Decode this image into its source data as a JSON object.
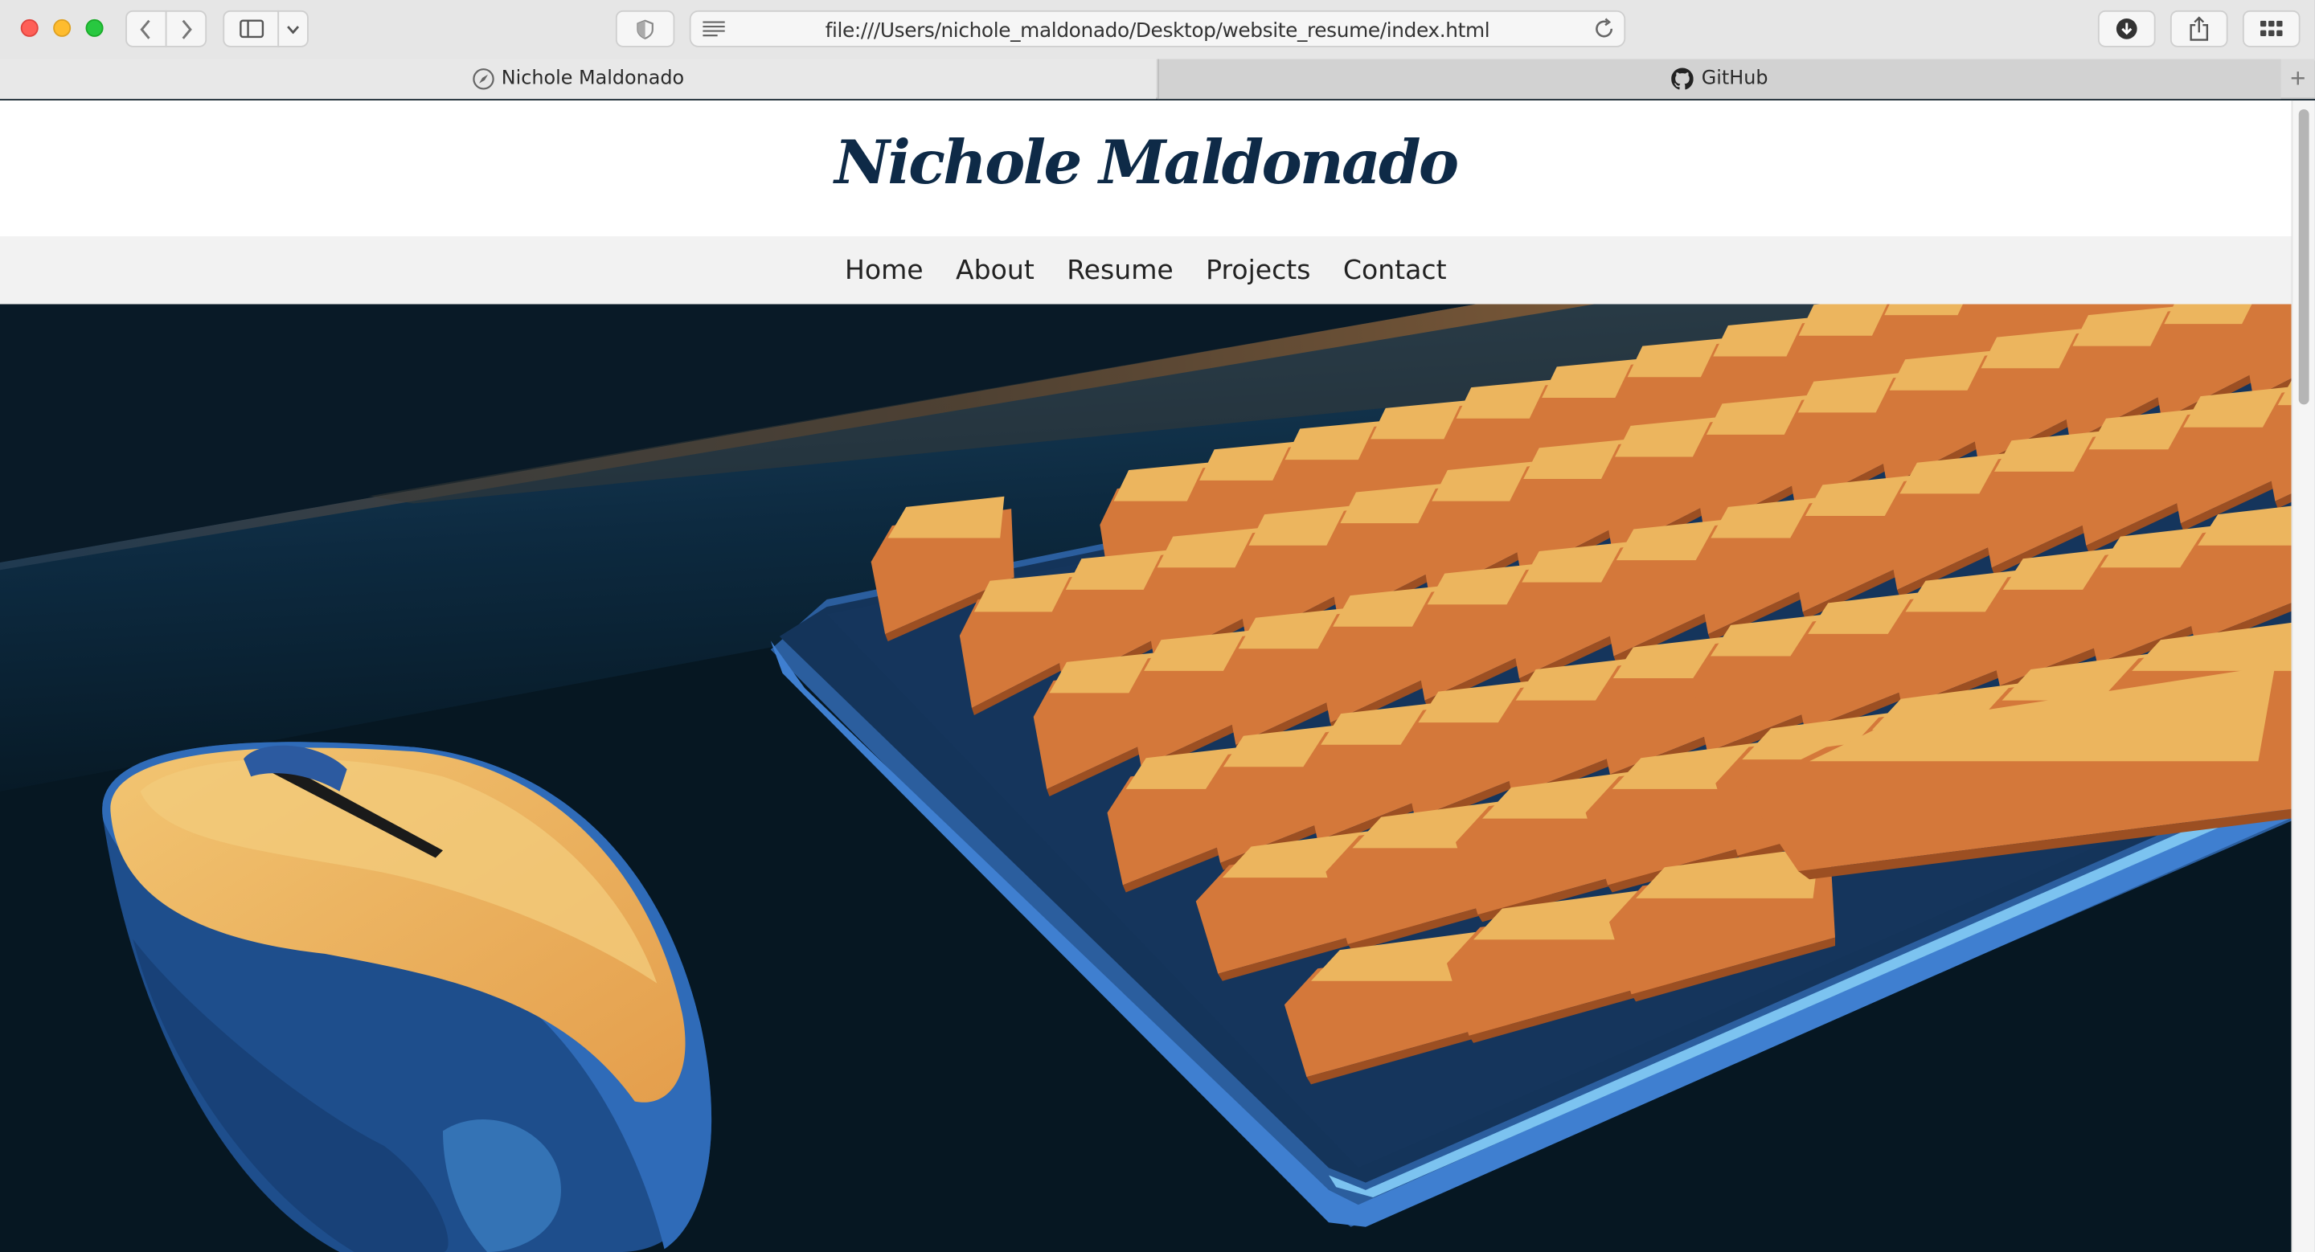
{
  "browser": {
    "url": "file:///Users/nichole_maldonado/Desktop/website_resume/index.html",
    "tabs": [
      {
        "label": "Nichole Maldonado",
        "icon": "compass-icon",
        "active": true
      },
      {
        "label": "GitHub",
        "icon": "github-icon",
        "active": false
      }
    ],
    "new_tab_label": "+"
  },
  "site": {
    "title": "Nichole Maldonado",
    "nav": [
      "Home",
      "About",
      "Resume",
      "Projects",
      "Contact"
    ]
  },
  "hero": {
    "image": "illustration of orange keyboard and mouse on dark blue desk"
  },
  "colors": {
    "title": "#0e2a47",
    "key_top": "#ecb55e",
    "key_side": "#d4783a",
    "desk": "#0b1f30",
    "keyboard_base": "#15345a",
    "keyboard_edge": "#3f7fd0"
  }
}
